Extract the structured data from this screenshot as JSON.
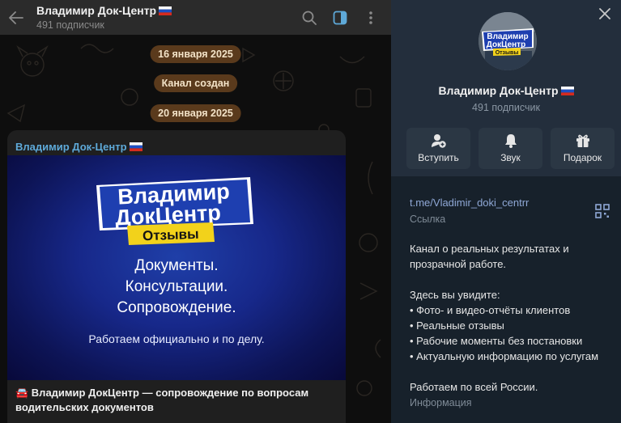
{
  "header": {
    "title": "Владимир Док-Центр",
    "subtitle": "491 подписчик",
    "icons": [
      "back-arrow-icon",
      "search-icon",
      "sidebar-toggle-icon",
      "more-vertical-icon"
    ]
  },
  "dates": [
    "16 января 2025",
    "Канал создан",
    "20 января 2025"
  ],
  "post": {
    "author": "Владимир Док-Центр",
    "image": {
      "logo_line1": "Владимир",
      "logo_line2": "ДокЦентр",
      "logo_badge": "Отзывы",
      "lines": [
        "Документы.",
        "Консультации.",
        "Сопровождение."
      ],
      "small": "Работаем официально и по делу."
    },
    "caption": "🚘 Владимир ДокЦентр — сопровождение по вопросам водительских документов"
  },
  "panel": {
    "avatar_text_1": "Владимир",
    "avatar_text_2": "ДокЦентр",
    "avatar_badge": "Отзывы",
    "name": "Владимир Док-Центр",
    "subtitle": "491 подписчик",
    "actions": [
      {
        "label": "Вступить",
        "icon": "join-icon"
      },
      {
        "label": "Звук",
        "icon": "bell-icon"
      },
      {
        "label": "Подарок",
        "icon": "gift-icon"
      }
    ],
    "link": "t.me/Vladimir_doki_centrr",
    "link_label": "Ссылка",
    "description": [
      "Канал о реальных результатах и",
      "прозрачной работе.",
      "",
      "Здесь вы увидите:",
      "• Фото- и видео-отчёты клиентов",
      "• Реальные отзывы",
      "• Рабочие моменты без постановки",
      "• Актуальную информацию по услугам",
      "",
      "Работаем по всей России."
    ],
    "info_label": "Информация"
  },
  "colors": {
    "accent_link": "#5ea9d8",
    "date_pill": "#5a3a1c",
    "panel_bg": "#17212b",
    "header_bg": "#2b2b2b"
  }
}
